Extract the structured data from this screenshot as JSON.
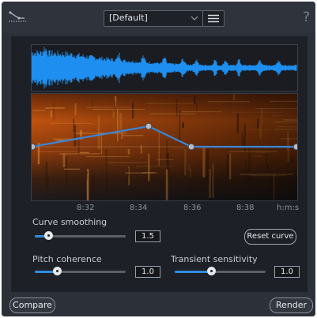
{
  "header": {
    "preset_value": "[Default]",
    "help_glyph": "?"
  },
  "timeline": {
    "ticks": [
      "8:32",
      "8:34",
      "8:36",
      "8:38"
    ],
    "unit": "h:m:s"
  },
  "controls": {
    "curve_smoothing": {
      "label": "Curve smoothing",
      "value": "1.5",
      "level": 0.15
    },
    "pitch_coherence": {
      "label": "Pitch coherence",
      "value": "1.0",
      "level": 0.25
    },
    "transient_sensitivity": {
      "label": "Transient sensitivity",
      "value": "1.0",
      "level": 0.4
    },
    "reset_label": "Reset curve"
  },
  "footer": {
    "compare_label": "Compare",
    "render_label": "Render"
  },
  "colors": {
    "accent": "#2f8be0",
    "waveform": "#1e8ff0",
    "curve": "#3a86d8",
    "spectrogram_hot": "#e8761a"
  }
}
